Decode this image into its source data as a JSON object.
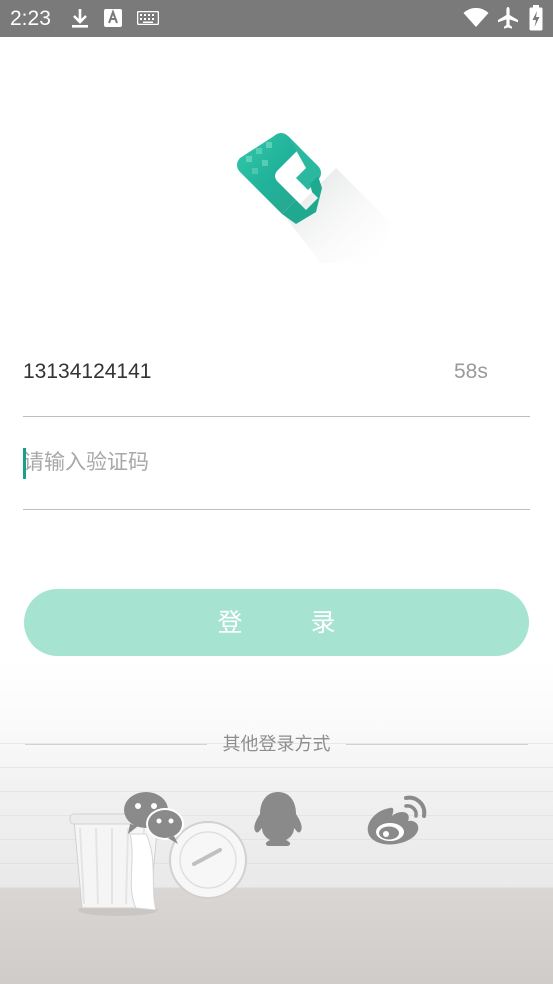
{
  "status_bar": {
    "time": "2:23",
    "left_icons": [
      "download-icon",
      "text-a-icon",
      "keyboard-icon"
    ],
    "right_icons": [
      "wifi-icon",
      "airplane-mode-icon",
      "battery-charging-icon"
    ]
  },
  "colors": {
    "accent": "#a6e3d0",
    "cursor": "#1b9e8c",
    "logo_teal": "#2fc0a6",
    "icon_gray": "#8a8a8a"
  },
  "form": {
    "phone_number": "13134124141",
    "countdown": "58s",
    "code_placeholder": "请输入验证码",
    "code_value": ""
  },
  "login_button": {
    "label": "登 录"
  },
  "other_login": {
    "label": "其他登录方式",
    "options": [
      {
        "name": "wechat",
        "icon": "wechat-icon"
      },
      {
        "name": "qq",
        "icon": "qq-icon"
      },
      {
        "name": "weibo",
        "icon": "weibo-icon"
      }
    ]
  }
}
